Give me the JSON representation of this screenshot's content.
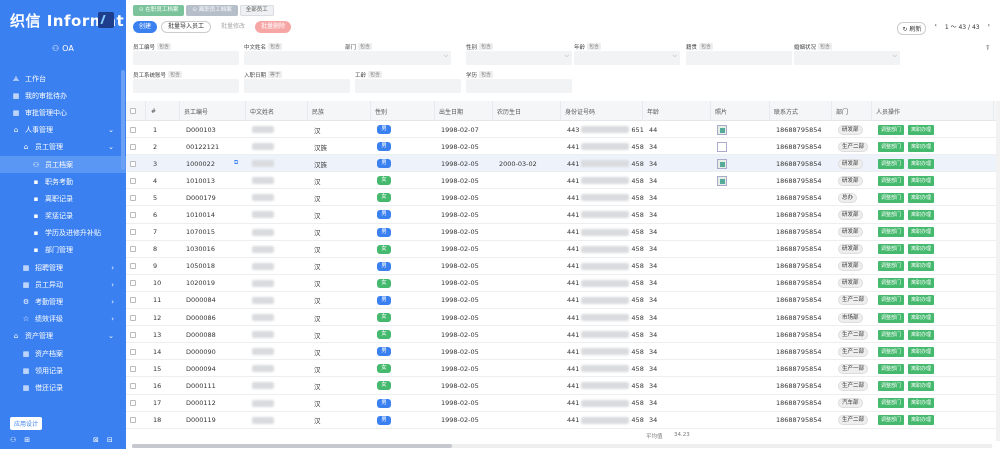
{
  "app": {
    "title": "织信 Informat",
    "user": "OA"
  },
  "sidebar": {
    "items": [
      {
        "label": "工作台",
        "level": 0,
        "icon": "chart-icon"
      },
      {
        "label": "我的审批待办",
        "level": 0,
        "icon": "grid-icon"
      },
      {
        "label": "审批管理中心",
        "level": 0,
        "icon": "grid-icon"
      },
      {
        "label": "人事管理",
        "level": 0,
        "icon": "home-icon",
        "arrow": "⌄"
      },
      {
        "label": "员工管理",
        "level": 1,
        "icon": "home-icon",
        "arrow": "⌄"
      },
      {
        "label": "员工档案",
        "level": 2,
        "icon": "user-icon",
        "active": true
      },
      {
        "label": "职务考勤",
        "level": 2,
        "icon": "square-icon"
      },
      {
        "label": "离职记录",
        "level": 2,
        "icon": "square-icon"
      },
      {
        "label": "奖惩记录",
        "level": 2,
        "icon": "square-icon"
      },
      {
        "label": "学历及进修升补贴",
        "level": 2,
        "icon": "square-icon"
      },
      {
        "label": "部门管理",
        "level": 2,
        "icon": "square-icon"
      },
      {
        "label": "招聘管理",
        "level": 1,
        "icon": "grid-icon",
        "arrow": "›"
      },
      {
        "label": "员工异动",
        "level": 1,
        "icon": "grid-icon",
        "arrow": "›"
      },
      {
        "label": "考勤管理",
        "level": 1,
        "icon": "gear-icon",
        "arrow": "›"
      },
      {
        "label": "绩效评级",
        "level": 1,
        "icon": "star-icon",
        "arrow": "›"
      },
      {
        "label": "资产管理",
        "level": 0,
        "icon": "home-icon",
        "arrow": "⌄"
      },
      {
        "label": "资产档案",
        "level": 1,
        "icon": "grid-icon"
      },
      {
        "label": "领用记录",
        "level": 1,
        "icon": "grid-icon"
      },
      {
        "label": "借还记录",
        "level": 1,
        "icon": "grid-icon"
      }
    ],
    "design_btn": "应用设计"
  },
  "tabs": [
    "在职员工档案",
    "离职员工档案",
    "全部员工"
  ],
  "toolbar": {
    "create": "创建",
    "import": "批量导入员工",
    "edit": "批量修改",
    "delete": "批量删除",
    "refresh": "刷新",
    "pager": "1 ～ 43 / 43"
  },
  "filters": {
    "row1": [
      "员工编号",
      "中文姓名",
      "部门",
      "性别",
      "年龄",
      "籍贯",
      "婚姻状况"
    ],
    "row2": [
      "员工系统账号",
      "入职日期",
      "工龄",
      "学历"
    ],
    "tag": "包含",
    "date_tag": "等于"
  },
  "columns": [
    "#",
    "员工编号",
    "中文姓名",
    "民族",
    "性别",
    "出生日期",
    "农历生日",
    "身份证号码",
    "年龄",
    "照片",
    "联系方式",
    "部门",
    "人员操作"
  ],
  "rows": [
    {
      "n": "1",
      "id": "D000103",
      "nation": "汉",
      "sex": "男",
      "birth": "1998-02-07",
      "lunar": "",
      "idc_a": "443",
      "idc_b": "651",
      "age": "44",
      "pic": "g",
      "phone": "18688795854",
      "dept": "研发部"
    },
    {
      "n": "2",
      "id": "00122121",
      "nation": "汉族",
      "sex": "男",
      "birth": "1998-02-05",
      "lunar": "",
      "idc_a": "441",
      "idc_b": "458",
      "age": "34",
      "pic": "w",
      "phone": "18688795854",
      "dept": "生产二部"
    },
    {
      "n": "3",
      "id": "1000022",
      "nation": "汉族",
      "sex": "男",
      "birth": "1998-02-05",
      "lunar": "2000-03-02",
      "idc_a": "441",
      "idc_b": "458",
      "age": "34",
      "pic": "g",
      "phone": "18688795854",
      "dept": "研发部"
    },
    {
      "n": "4",
      "id": "1010013",
      "nation": "汉",
      "sex": "女",
      "birth": "1998-02-05",
      "lunar": "",
      "idc_a": "441",
      "idc_b": "458",
      "age": "34",
      "pic": "g",
      "phone": "18688795854",
      "dept": "研发部"
    },
    {
      "n": "5",
      "id": "D000179",
      "nation": "汉",
      "sex": "女",
      "birth": "1998-02-05",
      "lunar": "",
      "idc_a": "441",
      "idc_b": "458",
      "age": "34",
      "pic": "",
      "phone": "18688795854",
      "dept": "总办"
    },
    {
      "n": "6",
      "id": "1010014",
      "nation": "汉",
      "sex": "男",
      "birth": "1998-02-05",
      "lunar": "",
      "idc_a": "441",
      "idc_b": "458",
      "age": "34",
      "pic": "",
      "phone": "18688795854",
      "dept": "研发部"
    },
    {
      "n": "7",
      "id": "1070015",
      "nation": "汉",
      "sex": "男",
      "birth": "1998-02-05",
      "lunar": "",
      "idc_a": "441",
      "idc_b": "458",
      "age": "34",
      "pic": "",
      "phone": "18688795854",
      "dept": "研发部"
    },
    {
      "n": "8",
      "id": "1030016",
      "nation": "汉",
      "sex": "女",
      "birth": "1998-02-05",
      "lunar": "",
      "idc_a": "441",
      "idc_b": "458",
      "age": "34",
      "pic": "",
      "phone": "18688795854",
      "dept": "研发部"
    },
    {
      "n": "9",
      "id": "1050018",
      "nation": "汉",
      "sex": "男",
      "birth": "1998-02-05",
      "lunar": "",
      "idc_a": "441",
      "idc_b": "458",
      "age": "34",
      "pic": "",
      "phone": "18688795854",
      "dept": "研发部"
    },
    {
      "n": "10",
      "id": "1020019",
      "nation": "汉",
      "sex": "女",
      "birth": "1998-02-05",
      "lunar": "",
      "idc_a": "441",
      "idc_b": "458",
      "age": "34",
      "pic": "",
      "phone": "18688795854",
      "dept": "研发部"
    },
    {
      "n": "11",
      "id": "D000084",
      "nation": "汉",
      "sex": "男",
      "birth": "1998-02-05",
      "lunar": "",
      "idc_a": "441",
      "idc_b": "458",
      "age": "34",
      "pic": "",
      "phone": "18688795854",
      "dept": "生产二部"
    },
    {
      "n": "12",
      "id": "D000086",
      "nation": "汉",
      "sex": "女",
      "birth": "1998-02-05",
      "lunar": "",
      "idc_a": "441",
      "idc_b": "458",
      "age": "34",
      "pic": "",
      "phone": "18688795854",
      "dept": "市场部"
    },
    {
      "n": "13",
      "id": "D000088",
      "nation": "汉",
      "sex": "女",
      "birth": "1998-02-05",
      "lunar": "",
      "idc_a": "441",
      "idc_b": "458",
      "age": "34",
      "pic": "",
      "phone": "18688795854",
      "dept": "生产二部"
    },
    {
      "n": "14",
      "id": "D000090",
      "nation": "汉",
      "sex": "男",
      "birth": "1998-02-05",
      "lunar": "",
      "idc_a": "441",
      "idc_b": "458",
      "age": "34",
      "pic": "",
      "phone": "18688795854",
      "dept": "生产二部"
    },
    {
      "n": "15",
      "id": "D000094",
      "nation": "汉",
      "sex": "女",
      "birth": "1998-02-05",
      "lunar": "",
      "idc_a": "441",
      "idc_b": "458",
      "age": "34",
      "pic": "",
      "phone": "18688795854",
      "dept": "生产一部"
    },
    {
      "n": "16",
      "id": "D000111",
      "nation": "汉",
      "sex": "女",
      "birth": "1998-02-05",
      "lunar": "",
      "idc_a": "441",
      "idc_b": "458",
      "age": "34",
      "pic": "",
      "phone": "18688795854",
      "dept": "生产二部"
    },
    {
      "n": "17",
      "id": "D000112",
      "nation": "汉",
      "sex": "男",
      "birth": "1998-02-05",
      "lunar": "",
      "idc_a": "441",
      "idc_b": "458",
      "age": "34",
      "pic": "",
      "phone": "18688795854",
      "dept": "汽车部"
    },
    {
      "n": "18",
      "id": "D000119",
      "nation": "汉",
      "sex": "男",
      "birth": "1998-02-05",
      "lunar": "",
      "idc_a": "441",
      "idc_b": "458",
      "age": "34",
      "pic": "",
      "phone": "18688795854",
      "dept": "生产二部"
    }
  ],
  "actions": {
    "transfer": "调整部门",
    "resign": "离职办理"
  },
  "footer": {
    "avg_label": "平均值",
    "avg_value": "34.23"
  }
}
